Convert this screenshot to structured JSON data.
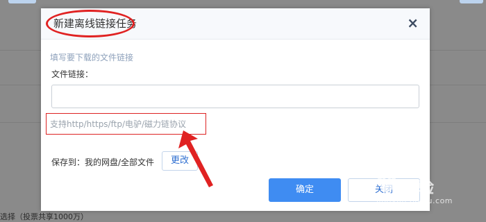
{
  "dialog": {
    "title": "新建离线链接任务",
    "close_symbol": "×",
    "hint_top": "填写要下载的文件链接",
    "link_label": "文件链接：",
    "link_value": "",
    "protocol_hint": "支持http/https/ftp/电驴/磁力链协议",
    "save_label": "保存到：我的网盘/全部文件",
    "change_label": "更改",
    "confirm_label": "确定",
    "cancel_label": "关闭"
  },
  "background": {
    "bottom_text": "选择（投票共享1000万）"
  },
  "watermark": {
    "title": "经验",
    "url": "jingyan.baidu.com"
  },
  "annotation_color": "#e02222",
  "icons": {
    "close": "close-icon",
    "arrow": "red-arrow-annotation",
    "paw": "paw-icon"
  }
}
